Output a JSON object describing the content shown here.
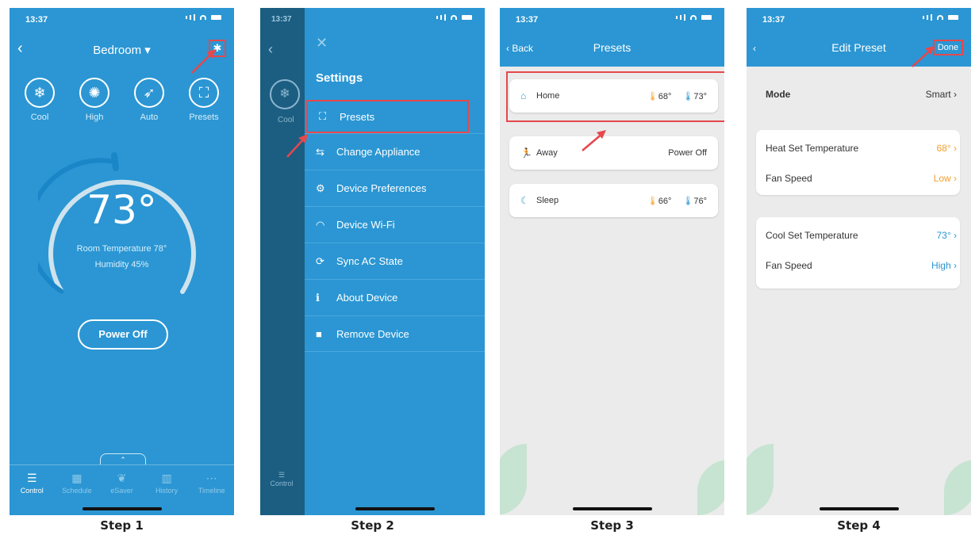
{
  "status_time": "13:37",
  "step1": {
    "title": "Bedroom ▾",
    "modes": [
      {
        "icon": "snowflake-icon",
        "glyph": "❄",
        "label": "Cool"
      },
      {
        "icon": "fan-icon",
        "glyph": "✺",
        "label": "High"
      },
      {
        "icon": "auto-icon",
        "glyph": "➶",
        "label": "Auto"
      },
      {
        "icon": "presets-icon",
        "glyph": "⛶",
        "label": "Presets"
      }
    ],
    "set_temp": "73°",
    "room_temp": "Room Temperature 78°",
    "humidity": "Humidity 45%",
    "power_button": "Power Off",
    "tabs": [
      {
        "icon": "control-icon",
        "glyph": "☰",
        "label": "Control"
      },
      {
        "icon": "schedule-icon",
        "glyph": "▦",
        "label": "Schedule"
      },
      {
        "icon": "esaver-icon",
        "glyph": "❦",
        "label": "eSaver"
      },
      {
        "icon": "history-icon",
        "glyph": "▥",
        "label": "History"
      },
      {
        "icon": "timeline-icon",
        "glyph": "⋯",
        "label": "Timeline"
      }
    ],
    "step_label": "Step 1"
  },
  "step2": {
    "dark_time": "13:37",
    "dark_mode_label": "Cool",
    "dark_tab_label": "Control",
    "settings_title": "Settings",
    "menu": [
      {
        "icon": "presets-icon",
        "glyph": "⛶",
        "label": "Presets"
      },
      {
        "icon": "swap-icon",
        "glyph": "⇆",
        "label": "Change Appliance"
      },
      {
        "icon": "gears-icon",
        "glyph": "⚙",
        "label": "Device Preferences"
      },
      {
        "icon": "wifi-icon",
        "glyph": "◠",
        "label": "Device Wi-Fi"
      },
      {
        "icon": "sync-icon",
        "glyph": "⟳",
        "label": "Sync AC State"
      },
      {
        "icon": "info-icon",
        "glyph": "ℹ",
        "label": "About Device"
      },
      {
        "icon": "trash-icon",
        "glyph": "■",
        "label": "Remove Device"
      }
    ],
    "step_label": "Step 2"
  },
  "step3": {
    "back": "Back",
    "title": "Presets",
    "presets": [
      {
        "icon": "home-icon",
        "glyph": "⌂",
        "name": "Home",
        "heat": "68°",
        "cool": "73°",
        "state": ""
      },
      {
        "icon": "running-icon",
        "glyph": "🏃",
        "name": "Away",
        "heat": "",
        "cool": "",
        "state": "Power Off"
      },
      {
        "icon": "moon-icon",
        "glyph": "☾",
        "name": "Sleep",
        "heat": "66°",
        "cool": "76°",
        "state": ""
      }
    ],
    "step_label": "Step 3"
  },
  "step4": {
    "title": "Edit Preset",
    "done": "Done",
    "mode_label": "Mode",
    "mode_value": "Smart",
    "heat_set_label": "Heat Set Temperature",
    "heat_set_value": "68°",
    "fan1_label": "Fan Speed",
    "fan1_value": "Low",
    "cool_set_label": "Cool Set Temperature",
    "cool_set_value": "73°",
    "fan2_label": "Fan Speed",
    "fan2_value": "High",
    "step_label": "Step 4"
  },
  "colors": {
    "app_blue": "#2b96d3",
    "highlight_red": "#e5484d",
    "heat_orange": "#f0a030"
  }
}
